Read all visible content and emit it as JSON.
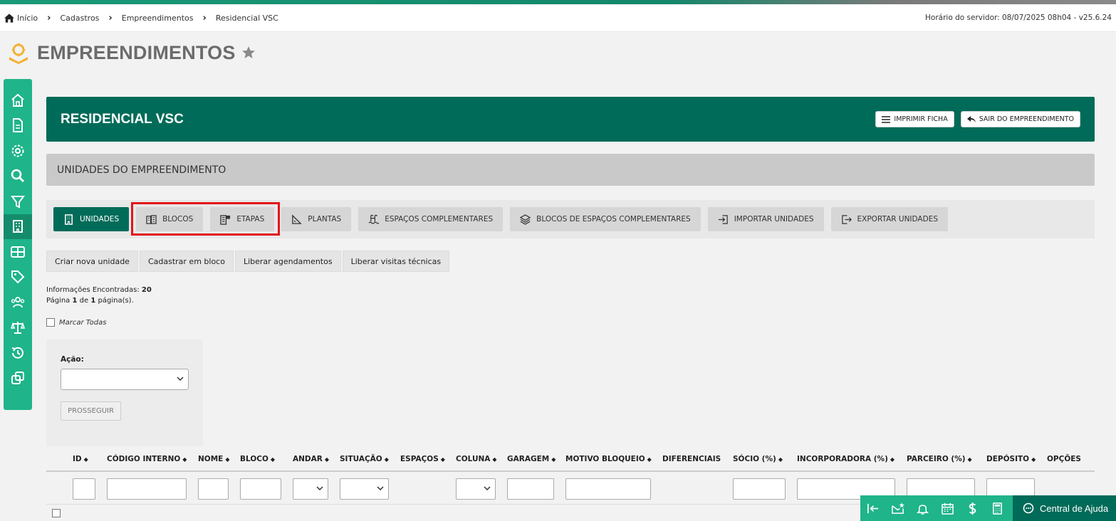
{
  "breadcrumb": [
    "Início",
    "Cadastros",
    "Empreendimentos",
    "Residencial VSC"
  ],
  "server_time": "Horário do servidor: 08/07/2025 08h04 - v25.6.24",
  "page_title": "EMPREENDIMENTOS",
  "banner": {
    "title": "RESIDENCIAL VSC",
    "print_label": "IMPRIMIR FICHA",
    "exit_label": "SAIR DO EMPREENDIMENTO"
  },
  "section_title": "UNIDADES DO EMPREENDIMENTO",
  "tabs": [
    {
      "label": "UNIDADES",
      "icon": "building-icon",
      "active": true
    },
    {
      "label": "BLOCOS",
      "icon": "blocks-icon",
      "active": false
    },
    {
      "label": "ETAPAS",
      "icon": "stages-icon",
      "active": false
    },
    {
      "label": "PLANTAS",
      "icon": "triangle-ruler-icon",
      "active": false
    },
    {
      "label": "ESPAÇOS COMPLEMENTARES",
      "icon": "pool-icon",
      "active": false
    },
    {
      "label": "BLOCOS DE ESPAÇOS COMPLEMENTARES",
      "icon": "layers-icon",
      "active": false
    },
    {
      "label": "IMPORTAR UNIDADES",
      "icon": "import-icon",
      "active": false
    },
    {
      "label": "EXPORTAR UNIDADES",
      "icon": "export-icon",
      "active": false
    }
  ],
  "actions": [
    "Criar nova unidade",
    "Cadastrar em bloco",
    "Liberar agendamentos",
    "Liberar visitas técnicas"
  ],
  "info": {
    "found_label": "Informações Encontradas:",
    "found_count": "20",
    "page_prefix": "Página",
    "page_current": "1",
    "page_of": "de",
    "page_total": "1",
    "page_suffix": "página(s)."
  },
  "mark_all": "Marcar Todas",
  "action_panel": {
    "label": "Ação:",
    "selected": "",
    "button": "PROSSEGUIR"
  },
  "table": {
    "columns": [
      "ID",
      "CÓDIGO INTERNO",
      "NOME",
      "BLOCO",
      "ANDAR",
      "SITUAÇÃO",
      "ESPAÇOS",
      "COLUNA",
      "GARAGEM",
      "MOTIVO BLOQUEIO",
      "DIFERENCIAIS",
      "SÓCIO (%)",
      "INCORPORADORA (%)",
      "PARCEIRO (%)",
      "DEPÓSITO",
      "OPÇÕES"
    ]
  },
  "help_label": "Central de Ajuda",
  "colors": {
    "primary": "#006b58",
    "accent": "#1fb48a",
    "highlight": "#e3141b"
  }
}
